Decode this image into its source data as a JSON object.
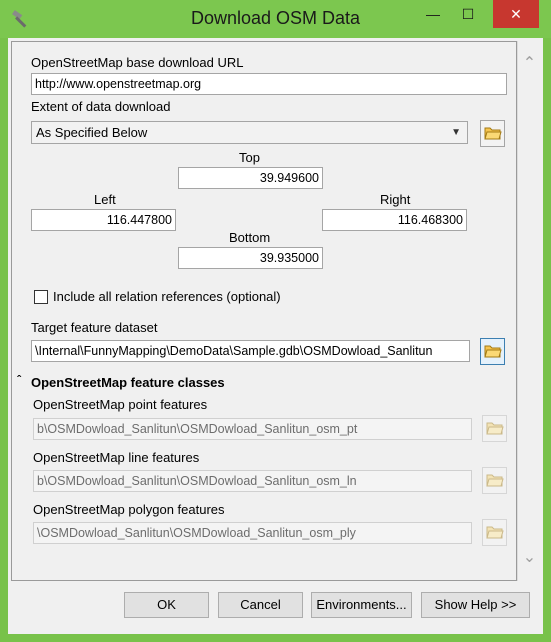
{
  "window": {
    "title": "Download OSM Data"
  },
  "titlebar_buttons": {
    "minimize": "—",
    "maximize": "☐",
    "close": "✕"
  },
  "form": {
    "url_label": "OpenStreetMap base download URL",
    "url_value": "http://www.openstreetmap.org",
    "extent_label": "Extent of data download",
    "extent_value": "As Specified Below",
    "top_label": "Top",
    "top_value": "39.949600",
    "left_label": "Left",
    "left_value": "116.447800",
    "right_label": "Right",
    "right_value": "116.468300",
    "bottom_label": "Bottom",
    "bottom_value": "39.935000",
    "include_relations_label": "Include all relation references (optional)",
    "include_relations_checked": false,
    "target_label": "Target feature dataset",
    "target_value": "\\Internal\\FunnyMapping\\DemoData\\Sample.gdb\\OSMDowload_Sanlitun",
    "section_title": "OpenStreetMap feature classes",
    "point_label": "OpenStreetMap point features",
    "point_value": "b\\OSMDowload_Sanlitun\\OSMDowload_Sanlitun_osm_pt",
    "line_label": "OpenStreetMap line features",
    "line_value": "b\\OSMDowload_Sanlitun\\OSMDowload_Sanlitun_osm_ln",
    "polygon_label": "OpenStreetMap polygon features",
    "polygon_value": "\\OSMDowload_Sanlitun\\OSMDowload_Sanlitun_osm_ply"
  },
  "buttons": {
    "ok": "OK",
    "cancel": "Cancel",
    "environments": "Environments...",
    "show_help": "Show Help >>"
  },
  "icons": {
    "app": "hammer-icon",
    "folder": "folder-open-icon",
    "collapse": "collapse-chevron-icon"
  },
  "colors": {
    "titlebar": "#7cc74f",
    "close": "#c7372f",
    "dialog": "#f0f0f0"
  }
}
